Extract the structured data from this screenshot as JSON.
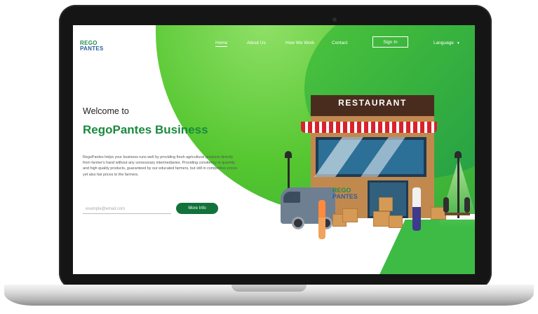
{
  "nav": {
    "logo_line1": "REGO",
    "logo_line2": "PANTES",
    "home": "Home",
    "about": "About Us",
    "how": "How We Work",
    "contact": "Contact",
    "signin": "Sign In",
    "language": "Language",
    "language_icon": "chevron-down-icon"
  },
  "hero": {
    "welcome": "Welcome to",
    "brand": "RegoPantes Business",
    "description": "RegoPantes helps your business runs well by providing fresh agricultural products directly from farmer's hand without any unnecesary intermediaries. Providing consitency in quantity and high quality products, guaranteed by our educated farmers, but still in competitive prices yet also fair prices to the farmers.",
    "email_placeholder": "example@email.com",
    "more_info": "More Info"
  },
  "illustration": {
    "sign_text": "RESTAURANT",
    "shop_logo_line1": "REGO",
    "shop_logo_line2": "PANTES"
  },
  "colors": {
    "brand_green": "#1a8a3f",
    "button_green": "#12723a",
    "accent_green": "#54c62f",
    "logo_blue": "#2c5f9e"
  }
}
